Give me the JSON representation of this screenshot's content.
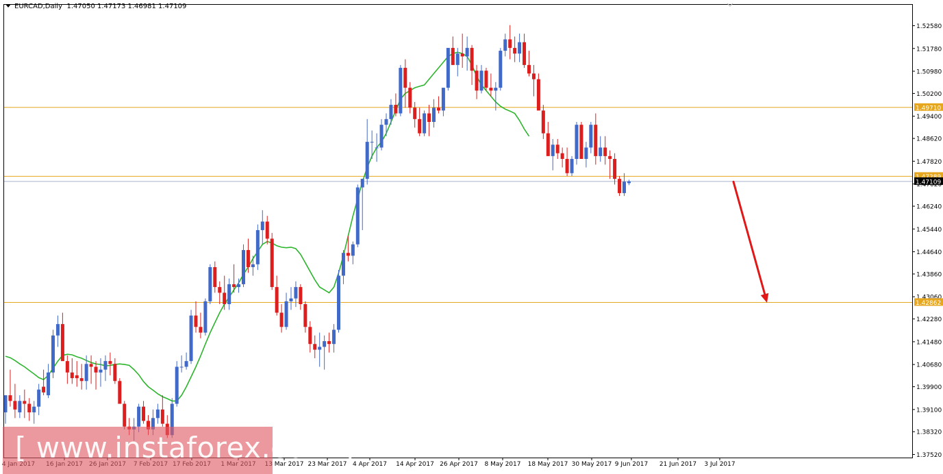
{
  "header": {
    "symbol_tf": "EURCAD,Daily",
    "ohlc": "1.47050 1.47173 1.46981 1.47109"
  },
  "watermark": "[ www.instaforex.com ]",
  "colors": {
    "bull": "#4169C8",
    "bear": "#DC1E1E",
    "ma": "#2DB52D",
    "level": "#E6A61E",
    "current_line": "#A9B0CF",
    "arrow": "#E01818",
    "frame": "#000000"
  },
  "chart_data": {
    "type": "candlestick",
    "title": "EURCAD,Daily",
    "y_ticks": [
      "1.52580",
      "1.51780",
      "1.50980",
      "1.50200",
      "1.49400",
      "1.48620",
      "1.47820",
      "1.47020",
      "1.46240",
      "1.45440",
      "1.44640",
      "1.43860",
      "1.43060",
      "1.42280",
      "1.41480",
      "1.40680",
      "1.39900",
      "1.39100",
      "1.38320",
      "1.37520"
    ],
    "ylim": [
      1.3752,
      1.5258
    ],
    "x_labels": [
      "4 Jan 2017",
      "16 Jan 2017",
      "26 Jan 2017",
      "7 Feb 2017",
      "17 Feb 2017",
      "1 Mar 2017",
      "13 Mar 2017",
      "23 Mar 2017",
      "4 Apr 2017",
      "14 Apr 2017",
      "26 Apr 2017",
      "8 May 2017",
      "18 May 2017",
      "30 May 2017",
      "9 Jun 2017",
      "21 Jun 2017",
      "3 Jul 2017"
    ],
    "levels": [
      {
        "label": "1.49710",
        "value": 1.4971
      },
      {
        "label": "1.47289",
        "value": 1.47289
      },
      {
        "label": "1.42862",
        "value": 1.42862
      }
    ],
    "current": {
      "label": "1.47109",
      "value": 1.47109
    },
    "arrow": {
      "from": 1.471,
      "to": 1.4285
    },
    "moving_average": [
      1.4097,
      1.4092,
      1.4082,
      1.407,
      1.406,
      1.4047,
      1.4035,
      1.4022,
      1.4015,
      1.403,
      1.4055,
      1.408,
      1.41,
      1.4104,
      1.4102,
      1.4095,
      1.409,
      1.4082,
      1.4075,
      1.407,
      1.4068,
      1.4063,
      1.4065,
      1.4068,
      1.407,
      1.4068,
      1.4065,
      1.405,
      1.4032,
      1.4008,
      1.399,
      1.3978,
      1.3965,
      1.3955,
      1.3948,
      1.394,
      1.394,
      1.396,
      1.399,
      1.4025,
      1.406,
      1.4098,
      1.414,
      1.418,
      1.4215,
      1.425,
      1.428,
      1.4305,
      1.433,
      1.4355,
      1.4385,
      1.441,
      1.444,
      1.4465,
      1.449,
      1.45,
      1.4495,
      1.4485,
      1.448,
      1.4478,
      1.448,
      1.4475,
      1.4455,
      1.4425,
      1.4395,
      1.4365,
      1.434,
      1.433,
      1.432,
      1.434,
      1.439,
      1.445,
      1.452,
      1.459,
      1.465,
      1.471,
      1.476,
      1.48,
      1.483,
      1.485,
      1.488,
      1.492,
      1.496,
      1.5,
      1.502,
      1.503,
      1.504,
      1.5045,
      1.505,
      1.507,
      1.509,
      1.511,
      1.513,
      1.515,
      1.516,
      1.5165,
      1.516,
      1.515,
      1.512,
      1.508,
      1.505,
      1.503,
      1.501,
      1.499,
      1.4975,
      1.4965,
      1.4958,
      1.495,
      1.4925,
      1.4895,
      1.487
    ],
    "candles": [
      [
        1.39,
        1.396,
        1.386,
        1.396
      ],
      [
        1.396,
        1.405,
        1.392,
        1.394
      ],
      [
        1.394,
        1.4,
        1.388,
        1.391
      ],
      [
        1.39,
        1.396,
        1.388,
        1.394
      ],
      [
        1.394,
        1.398,
        1.388,
        1.393
      ],
      [
        1.393,
        1.395,
        1.387,
        1.39
      ],
      [
        1.39,
        1.394,
        1.386,
        1.392
      ],
      [
        1.392,
        1.4,
        1.389,
        1.398
      ],
      [
        1.399,
        1.405,
        1.396,
        1.397
      ],
      [
        1.396,
        1.407,
        1.395,
        1.404
      ],
      [
        1.404,
        1.419,
        1.402,
        1.417
      ],
      [
        1.417,
        1.424,
        1.413,
        1.421
      ],
      [
        1.421,
        1.425,
        1.41,
        1.408
      ],
      [
        1.408,
        1.41,
        1.4,
        1.404
      ],
      [
        1.404,
        1.409,
        1.4,
        1.402
      ],
      [
        1.403,
        1.408,
        1.399,
        1.402
      ],
      [
        1.402,
        1.407,
        1.398,
        1.401
      ],
      [
        1.401,
        1.41,
        1.398,
        1.407
      ],
      [
        1.407,
        1.41,
        1.4,
        1.406
      ],
      [
        1.406,
        1.408,
        1.398,
        1.404
      ],
      [
        1.404,
        1.409,
        1.399,
        1.405
      ],
      [
        1.405,
        1.41,
        1.401,
        1.408
      ],
      [
        1.408,
        1.411,
        1.403,
        1.407
      ],
      [
        1.407,
        1.409,
        1.4,
        1.401
      ],
      [
        1.401,
        1.402,
        1.393,
        1.393
      ],
      [
        1.393,
        1.394,
        1.384,
        1.385
      ],
      [
        1.385,
        1.388,
        1.382,
        1.384
      ],
      [
        1.384,
        1.388,
        1.38,
        1.385
      ],
      [
        1.385,
        1.393,
        1.383,
        1.392
      ],
      [
        1.392,
        1.394,
        1.386,
        1.387
      ],
      [
        1.387,
        1.389,
        1.382,
        1.384
      ],
      [
        1.384,
        1.391,
        1.382,
        1.388
      ],
      [
        1.388,
        1.393,
        1.386,
        1.391
      ],
      [
        1.391,
        1.396,
        1.385,
        1.386
      ],
      [
        1.386,
        1.389,
        1.381,
        1.382
      ],
      [
        1.382,
        1.395,
        1.381,
        1.393
      ],
      [
        1.393,
        1.408,
        1.392,
        1.406
      ],
      [
        1.406,
        1.41,
        1.404,
        1.406
      ],
      [
        1.406,
        1.411,
        1.405,
        1.408
      ],
      [
        1.408,
        1.426,
        1.407,
        1.424
      ],
      [
        1.424,
        1.429,
        1.418,
        1.42
      ],
      [
        1.42,
        1.425,
        1.416,
        1.418
      ],
      [
        1.418,
        1.43,
        1.417,
        1.429
      ],
      [
        1.429,
        1.442,
        1.428,
        1.441
      ],
      [
        1.441,
        1.443,
        1.432,
        1.434
      ],
      [
        1.434,
        1.436,
        1.428,
        1.432
      ],
      [
        1.432,
        1.438,
        1.426,
        1.428
      ],
      [
        1.428,
        1.437,
        1.426,
        1.435
      ],
      [
        1.435,
        1.442,
        1.432,
        1.434
      ],
      [
        1.434,
        1.437,
        1.432,
        1.435
      ],
      [
        1.435,
        1.449,
        1.434,
        1.447
      ],
      [
        1.447,
        1.451,
        1.439,
        1.441
      ],
      [
        1.441,
        1.445,
        1.438,
        1.442
      ],
      [
        1.442,
        1.456,
        1.44,
        1.454
      ],
      [
        1.454,
        1.461,
        1.449,
        1.457
      ],
      [
        1.457,
        1.459,
        1.449,
        1.451
      ],
      [
        1.451,
        1.453,
        1.433,
        1.434
      ],
      [
        1.434,
        1.438,
        1.424,
        1.425
      ],
      [
        1.425,
        1.428,
        1.418,
        1.42
      ],
      [
        1.42,
        1.432,
        1.419,
        1.429
      ],
      [
        1.429,
        1.434,
        1.426,
        1.43
      ],
      [
        1.43,
        1.436,
        1.427,
        1.434
      ],
      [
        1.434,
        1.435,
        1.426,
        1.428
      ],
      [
        1.428,
        1.429,
        1.418,
        1.42
      ],
      [
        1.42,
        1.422,
        1.411,
        1.414
      ],
      [
        1.414,
        1.417,
        1.409,
        1.412
      ],
      [
        1.412,
        1.418,
        1.406,
        1.413
      ],
      [
        1.413,
        1.417,
        1.405,
        1.415
      ],
      [
        1.415,
        1.418,
        1.411,
        1.414
      ],
      [
        1.414,
        1.421,
        1.411,
        1.419
      ],
      [
        1.419,
        1.44,
        1.418,
        1.438
      ],
      [
        1.438,
        1.447,
        1.435,
        1.446
      ],
      [
        1.446,
        1.452,
        1.443,
        1.445
      ],
      [
        1.445,
        1.45,
        1.442,
        1.449
      ],
      [
        1.449,
        1.47,
        1.448,
        1.469
      ],
      [
        1.469,
        1.472,
        1.454,
        1.472
      ],
      [
        1.472,
        1.493,
        1.47,
        1.485
      ],
      [
        1.485,
        1.489,
        1.479,
        1.485
      ],
      [
        1.483,
        1.488,
        1.478,
        1.483
      ],
      [
        1.483,
        1.493,
        1.482,
        1.491
      ],
      [
        1.491,
        1.495,
        1.487,
        1.493
      ],
      [
        1.493,
        1.5,
        1.491,
        1.498
      ],
      [
        1.498,
        1.502,
        1.494,
        1.495
      ],
      [
        1.495,
        1.512,
        1.494,
        1.511
      ],
      [
        1.511,
        1.514,
        1.497,
        1.504
      ],
      [
        1.504,
        1.506,
        1.495,
        1.497
      ],
      [
        1.497,
        1.499,
        1.49,
        1.493
      ],
      [
        1.493,
        1.497,
        1.487,
        1.488
      ],
      [
        1.488,
        1.496,
        1.487,
        1.495
      ],
      [
        1.495,
        1.498,
        1.487,
        1.492
      ],
      [
        1.492,
        1.5,
        1.49,
        1.497
      ],
      [
        1.497,
        1.501,
        1.495,
        1.496
      ],
      [
        1.496,
        1.504,
        1.494,
        1.504
      ],
      [
        1.504,
        1.517,
        1.503,
        1.518
      ],
      [
        1.518,
        1.522,
        1.512,
        1.512
      ],
      [
        1.512,
        1.518,
        1.508,
        1.516
      ],
      [
        1.516,
        1.523,
        1.511,
        1.515
      ],
      [
        1.515,
        1.522,
        1.51,
        1.518
      ],
      [
        1.518,
        1.519,
        1.505,
        1.51
      ],
      [
        1.51,
        1.512,
        1.5,
        1.503
      ],
      [
        1.503,
        1.512,
        1.502,
        1.51
      ],
      [
        1.51,
        1.511,
        1.503,
        1.504
      ],
      [
        1.504,
        1.509,
        1.501,
        1.503
      ],
      [
        1.503,
        1.506,
        1.496,
        1.504
      ],
      [
        1.504,
        1.518,
        1.503,
        1.517
      ],
      [
        1.517,
        1.523,
        1.515,
        1.521
      ],
      [
        1.521,
        1.526,
        1.514,
        1.518
      ],
      [
        1.518,
        1.522,
        1.513,
        1.516
      ],
      [
        1.516,
        1.523,
        1.513,
        1.52
      ],
      [
        1.52,
        1.523,
        1.511,
        1.512
      ],
      [
        1.512,
        1.517,
        1.508,
        1.509
      ],
      [
        1.509,
        1.512,
        1.501,
        1.507
      ],
      [
        1.507,
        1.509,
        1.497,
        1.496
      ],
      [
        1.496,
        1.498,
        1.486,
        1.488
      ],
      [
        1.488,
        1.492,
        1.48,
        1.48
      ],
      [
        1.48,
        1.486,
        1.475,
        1.484
      ],
      [
        1.484,
        1.486,
        1.479,
        1.481
      ],
      [
        1.481,
        1.483,
        1.476,
        1.479
      ],
      [
        1.479,
        1.483,
        1.473,
        1.474
      ],
      [
        1.474,
        1.48,
        1.473,
        1.479
      ],
      [
        1.479,
        1.492,
        1.477,
        1.491
      ],
      [
        1.491,
        1.492,
        1.48,
        1.479
      ],
      [
        1.479,
        1.485,
        1.476,
        1.483
      ],
      [
        1.483,
        1.492,
        1.481,
        1.491
      ],
      [
        1.491,
        1.495,
        1.477,
        1.48
      ],
      [
        1.48,
        1.487,
        1.478,
        1.483
      ],
      [
        1.483,
        1.487,
        1.477,
        1.48
      ],
      [
        1.48,
        1.482,
        1.472,
        1.479
      ],
      [
        1.479,
        1.481,
        1.47,
        1.472
      ],
      [
        1.472,
        1.473,
        1.466,
        1.467
      ],
      [
        1.467,
        1.474,
        1.466,
        1.471
      ],
      [
        1.4705,
        1.4717,
        1.4698,
        1.4711
      ]
    ]
  }
}
